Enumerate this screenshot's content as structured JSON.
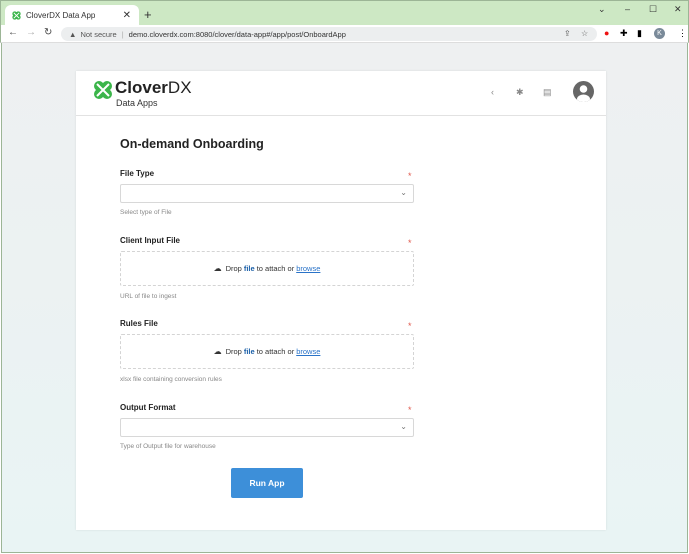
{
  "browser": {
    "tab_title": "CloverDX Data App",
    "not_secure": "Not secure",
    "url": "demo.cloverdx.com:8080/clover/data-app#/app/post/OnboardApp",
    "profile_initial": "K"
  },
  "app": {
    "brand_bold": "Clover",
    "brand_rest": "DX",
    "subtitle": "Data Apps",
    "brand_color": "#3bb54a"
  },
  "form": {
    "title": "On-demand Onboarding",
    "fields": [
      {
        "label": "File Type",
        "required": "*",
        "help": "Select type of File",
        "value": ""
      },
      {
        "label": "Client Input File",
        "required": "*",
        "help": "URL of file to ingest",
        "drop_pre": "Drop",
        "drop_file": "file",
        "drop_mid": "to attach or",
        "drop_link": "browse"
      },
      {
        "label": "Rules File",
        "required": "*",
        "help": "xlsx file containing conversion rules",
        "drop_pre": "Drop",
        "drop_file": "file",
        "drop_mid": "to attach or",
        "drop_link": "browse"
      },
      {
        "label": "Output Format",
        "required": "*",
        "help": "Type of Output file for warehouse",
        "value": ""
      }
    ],
    "run_label": "Run App"
  }
}
